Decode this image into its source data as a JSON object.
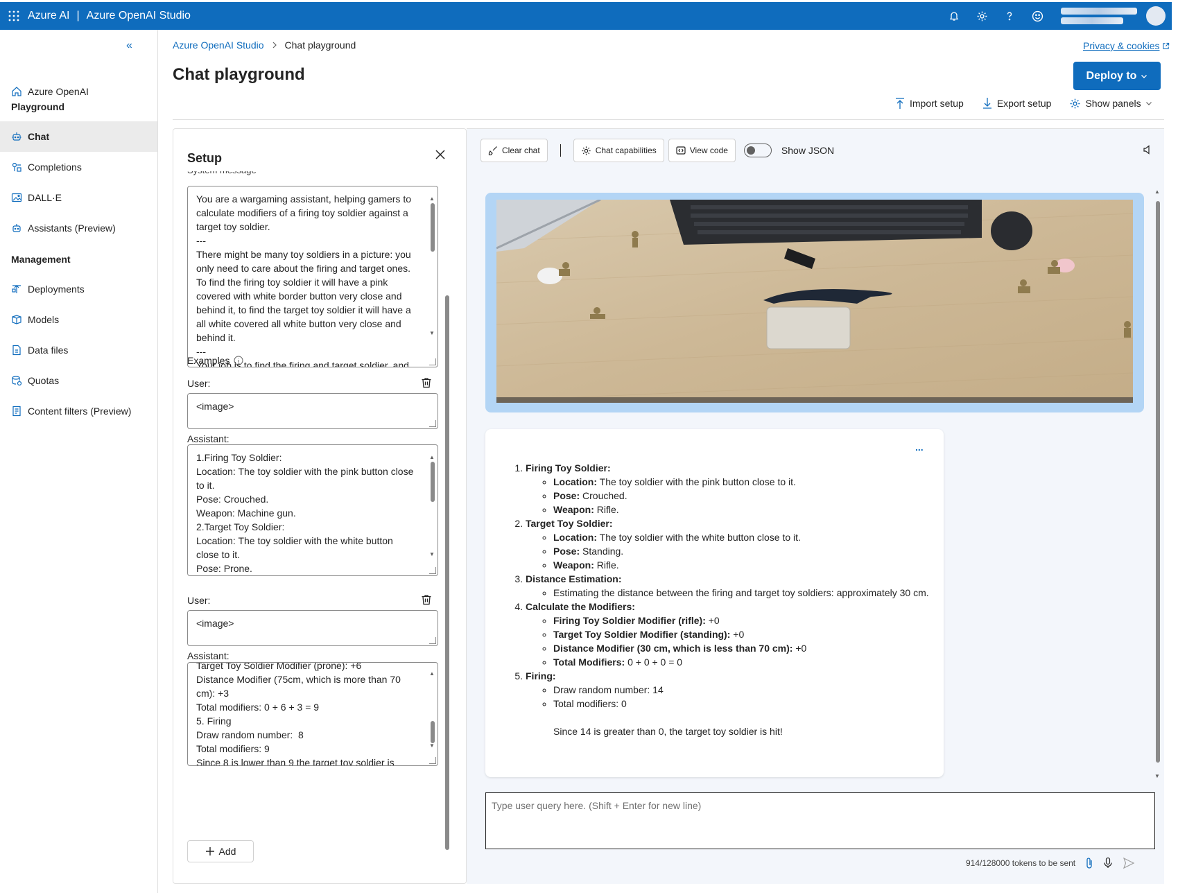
{
  "topbar": {
    "brand": "Azure AI",
    "separator": "|",
    "product": "Azure OpenAI Studio"
  },
  "nav": {
    "items": [
      {
        "label": "Azure OpenAI",
        "icon": "home-icon"
      },
      {
        "label": "Chat",
        "icon": "chat-bot-icon",
        "active": true
      },
      {
        "label": "Completions",
        "icon": "completions-icon"
      },
      {
        "label": "DALL·E",
        "icon": "image-icon"
      },
      {
        "label": "Assistants (Preview)",
        "icon": "assistant-icon"
      },
      {
        "label": "Deployments",
        "icon": "deployments-icon"
      },
      {
        "label": "Models",
        "icon": "models-icon"
      },
      {
        "label": "Data files",
        "icon": "data-files-icon"
      },
      {
        "label": "Quotas",
        "icon": "quotas-icon"
      },
      {
        "label": "Content filters (Preview)",
        "icon": "content-filters-icon"
      }
    ],
    "headings": [
      "Playground",
      "Management"
    ]
  },
  "header": {
    "breadcrumb_root": "Azure OpenAI Studio",
    "breadcrumb_current": "Chat playground",
    "title": "Chat playground",
    "privacy": "Privacy & cookies",
    "deploy": "Deploy to",
    "import_setup": "Import setup",
    "export_setup": "Export setup",
    "show_panels": "Show panels"
  },
  "setup": {
    "title": "Setup",
    "system_message_label": "System message",
    "system_message": "You are a wargaming assistant, helping gamers to calculate modifiers of a firing toy soldier against a target toy soldier.\n---\nThere might be many toy soldiers in a picture: you only need to care about the firing and target ones. To find the firing toy soldier it will have a pink covered with white border button very close and behind it, to find the target toy soldier it will have a all white covered all white button very close and behind it.\n---\nYour job is to find the firing and target soldier, and",
    "examples_label": "Examples",
    "user_label": "User:",
    "assistant_label": "Assistant:",
    "example1_user": "<image>",
    "example1_assistant": "1.Firing Toy Soldier:\nLocation: The toy soldier with the pink button close to it.\nPose: Crouched.\nWeapon: Machine gun.\n2.Target Toy Soldier:\nLocation: The toy soldier with the white button close to it.\nPose: Prone.\nWeapon: Rifle.",
    "example2_user": "<image>",
    "example2_assistant": "Target Toy Soldier Modifier (prone): +6\nDistance Modifier (75cm, which is more than 70 cm): +3\nTotal modifiers: 0 + 6 + 3 = 9\n5. Firing\nDraw random number:  8\nTotal modifiers: 9\nSince 8 is lower than 9 the target toy soldier is miss!",
    "add": "Add"
  },
  "chat": {
    "clear_chat": "Clear chat",
    "chat_capabilities": "Chat capabilities",
    "view_code": "View code",
    "show_json": "Show JSON",
    "dots": "...",
    "input_placeholder": "Type user query here. (Shift + Enter for new line)",
    "tokens": "914/128000 tokens to be sent",
    "reply": {
      "s1": {
        "title": "Firing Toy Soldier:",
        "items": [
          {
            "k": "Location:",
            "v": " The toy soldier with the pink button close to it."
          },
          {
            "k": "Pose:",
            "v": " Crouched."
          },
          {
            "k": "Weapon:",
            "v": " Rifle."
          }
        ]
      },
      "s2": {
        "title": "Target Toy Soldier:",
        "items": [
          {
            "k": "Location:",
            "v": " The toy soldier with the white button close to it."
          },
          {
            "k": "Pose:",
            "v": " Standing."
          },
          {
            "k": "Weapon:",
            "v": " Rifle."
          }
        ]
      },
      "s3": {
        "title": "Distance Estimation:",
        "items": [
          {
            "v": "Estimating the distance between the firing and target toy soldiers: approximately 30 cm."
          }
        ]
      },
      "s4": {
        "title": "Calculate the Modifiers:",
        "items": [
          {
            "k": "Firing Toy Soldier Modifier (rifle):",
            "v": " +0"
          },
          {
            "k": "Target Toy Soldier Modifier (standing):",
            "v": " +0"
          },
          {
            "k": "Distance Modifier (30 cm, which is less than 70 cm):",
            "v": " +0"
          },
          {
            "k": "Total Modifiers:",
            "v": " 0 + 0 + 0 = 0"
          }
        ]
      },
      "s5": {
        "title": "Firing:",
        "items": [
          {
            "v": "Draw random number: 14"
          },
          {
            "v": "Total modifiers: 0"
          }
        ],
        "note": "Since 14 is greater than 0, the target toy soldier is hit!"
      }
    }
  }
}
